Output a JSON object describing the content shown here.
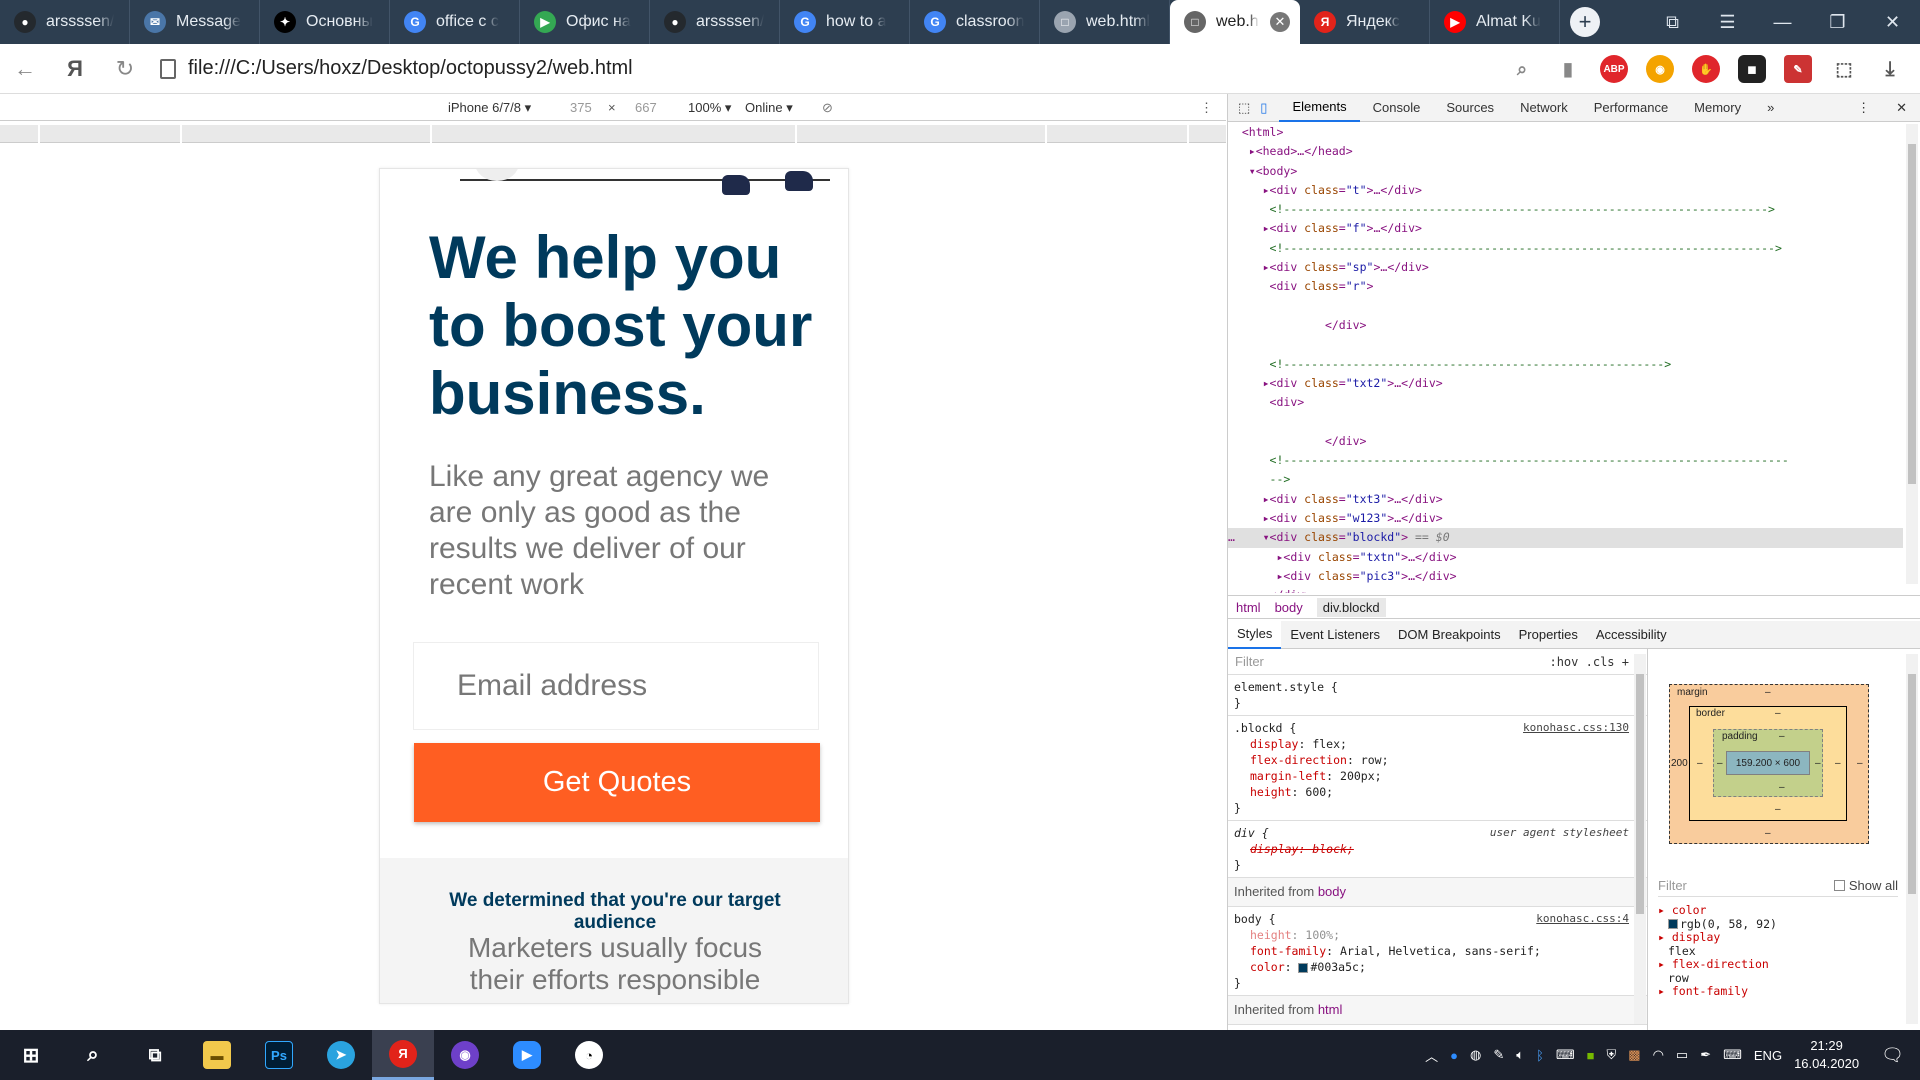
{
  "browser": {
    "tabs": [
      {
        "label": "arssssen/",
        "icon": "github-icon",
        "color": "#24292e",
        "glyph": "●"
      },
      {
        "label": "Message",
        "icon": "message-icon",
        "color": "#4a76a8",
        "glyph": "✉"
      },
      {
        "label": "Основны",
        "icon": "squarespace-icon",
        "color": "#000000",
        "glyph": "✦"
      },
      {
        "label": "office c c",
        "icon": "google-icon",
        "color": "#4285f4",
        "glyph": "G"
      },
      {
        "label": "Офис на",
        "icon": "play-icon",
        "color": "#34a853",
        "glyph": "▶"
      },
      {
        "label": "arssssen/",
        "icon": "github-icon",
        "color": "#24292e",
        "glyph": "●"
      },
      {
        "label": "how to a",
        "icon": "google-icon",
        "color": "#4285f4",
        "glyph": "G"
      },
      {
        "label": "classroon",
        "icon": "google-icon",
        "color": "#4285f4",
        "glyph": "G"
      },
      {
        "label": "web.html",
        "icon": "file-icon",
        "color": "#9aa4b0",
        "glyph": "□"
      },
      {
        "label": "web.h",
        "icon": "file-icon",
        "color": "#666666",
        "glyph": "□",
        "active": true
      },
      {
        "label": "Яндекс",
        "icon": "yandex-icon",
        "color": "#e2231a",
        "glyph": "Я"
      },
      {
        "label": "Almat Ku",
        "icon": "youtube-icon",
        "color": "#ff0000",
        "glyph": "▶"
      }
    ],
    "url": "file:///C:/Users/hoxz/Desktop/octopussy2/web.html"
  },
  "device_toolbar": {
    "device": "iPhone 6/7/8",
    "width": "375",
    "times": "×",
    "height": "667",
    "zoom": "100%",
    "network": "Online"
  },
  "page": {
    "hero": "We help you to boost your business.",
    "subtitle": "Like any great agency we are only as good as the results we deliver of our recent work",
    "email_placeholder": "Email address",
    "cta": "Get Quotes",
    "target_title": "We determined that you're our target audience",
    "target_text": "Marketers usually focus their efforts responsible"
  },
  "devtools": {
    "tabs": [
      "Elements",
      "Console",
      "Sources",
      "Network",
      "Performance",
      "Memory"
    ],
    "more": "»",
    "breadcrumbs": [
      "html",
      "body",
      "div.blockd"
    ],
    "subtabs": [
      "Styles",
      "Event Listeners",
      "DOM Breakpoints",
      "Properties",
      "Accessibility"
    ],
    "filter_placeholder": "Filter",
    "hov": ":hov",
    "cls": ".cls",
    "element_style": "element.style {",
    "blockd_selector": ".blockd {",
    "blockd_src": "konohasc.css:130",
    "blockd_props": [
      {
        "name": "display",
        "value": "flex;"
      },
      {
        "name": "flex-direction",
        "value": "row;"
      },
      {
        "name": "margin-left",
        "value": "200px;"
      },
      {
        "name": "height",
        "value": "600;"
      }
    ],
    "div_selector": "div {",
    "div_src": "user agent stylesheet",
    "div_prop": "display: block;",
    "inherited_body": "Inherited from",
    "inherited_body_tag": "body",
    "body_selector": "body {",
    "body_src": "konohasc.css:4",
    "body_props": [
      {
        "name": "height",
        "value": "100%;"
      },
      {
        "name": "font-family",
        "value": "Arial, Helvetica, sans-serif;"
      },
      {
        "name": "color",
        "value": "#003a5c;"
      }
    ],
    "inherited_html": "Inherited from",
    "inherited_html_tag": "html",
    "box_model": {
      "margin": "margin",
      "border": "border",
      "padding": "padding",
      "dash": "–",
      "margin_left": "200",
      "content": "159.200 × 600"
    },
    "computed_filter": "Filter",
    "show_all": "Show all",
    "computed": [
      {
        "name": "color",
        "value": "rgb(0, 58, 92)"
      },
      {
        "name": "display",
        "value": "flex"
      },
      {
        "name": "flex-direction",
        "value": "row"
      },
      {
        "name": "font-family",
        "value": ""
      }
    ]
  },
  "taskbar": {
    "lang": "ENG",
    "time": "21:29",
    "date": "16.04.2020"
  }
}
